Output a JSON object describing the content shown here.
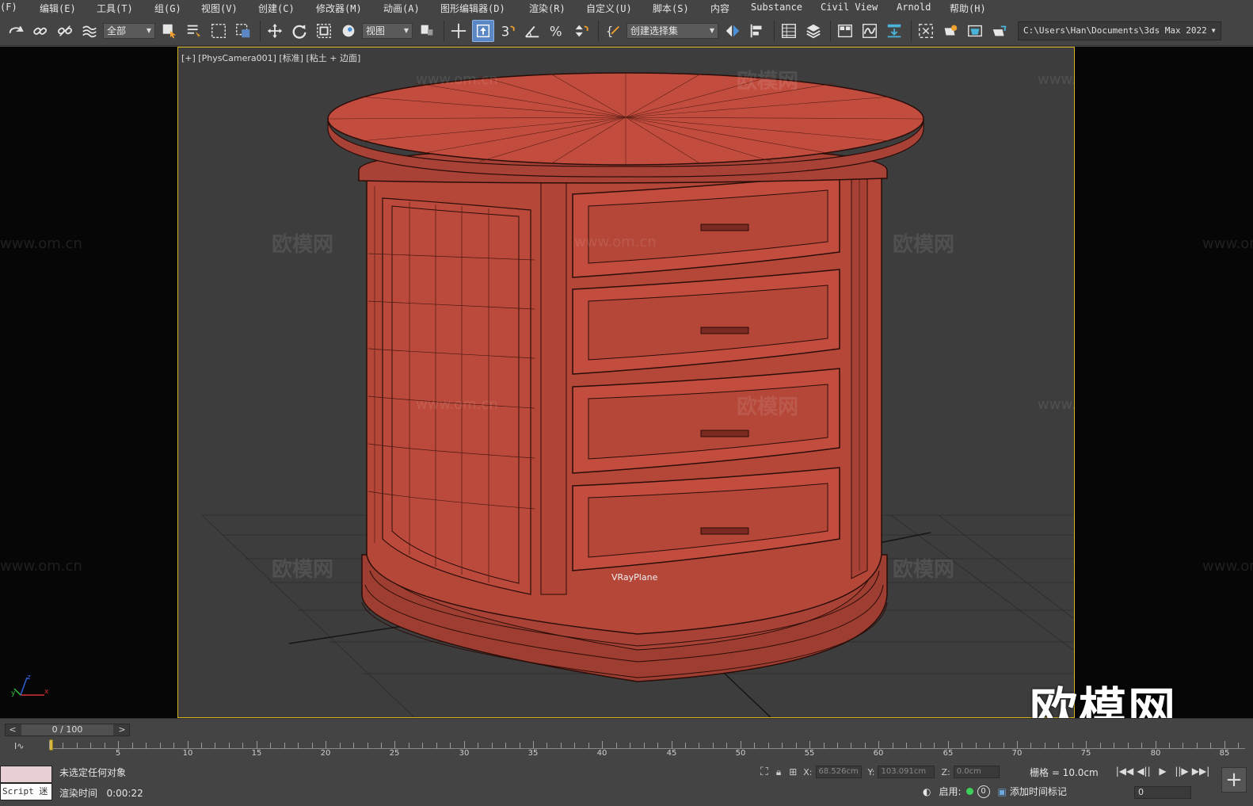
{
  "menu": [
    "(F)",
    "编辑(E)",
    "工具(T)",
    "组(G)",
    "视图(V)",
    "创建(C)",
    "修改器(M)",
    "动画(A)",
    "图形编辑器(D)",
    "渲染(R)",
    "自定义(U)",
    "脚本(S)",
    "内容",
    "Substance",
    "Civil View",
    "Arnold",
    "帮助(H)"
  ],
  "toolbar": {
    "filter_label": "全部",
    "refcoord_label": "视图",
    "selection_set_label": "创建选择集",
    "snap_label": "3",
    "path": "C:\\Users\\Han\\Documents\\3ds Max 2022"
  },
  "viewport": {
    "label": "[+] [PhysCamera001] [标准] [粘土 + 边面]",
    "object_label": "VRayPlane",
    "watermark_cn": "欧模网",
    "watermark_url": "www.om.cn",
    "logo_text": "欧模网",
    "model_color": "#b84a3c",
    "border_color": "#d7b41f"
  },
  "timeline": {
    "current": "0 / 100",
    "tick_labels": [
      "5",
      "10",
      "15",
      "20",
      "25",
      "30",
      "35",
      "40",
      "45",
      "50",
      "55",
      "60",
      "65",
      "70",
      "75",
      "80",
      "85"
    ]
  },
  "status": {
    "script_label": "Script 迷",
    "message": "未选定任何对象",
    "render_time_label": "渲染时间",
    "render_time_value": "0:00:22",
    "x_label": "X:",
    "x_value": "68.526cm",
    "y_label": "Y:",
    "y_value": "103.091cm",
    "z_label": "Z:",
    "z_value": "0.0cm",
    "grid": "栅格 = 10.0cm",
    "enable_label": "启用:",
    "enable_count": "0",
    "add_time_tag": "添加时间标记",
    "frame_value": "0"
  }
}
